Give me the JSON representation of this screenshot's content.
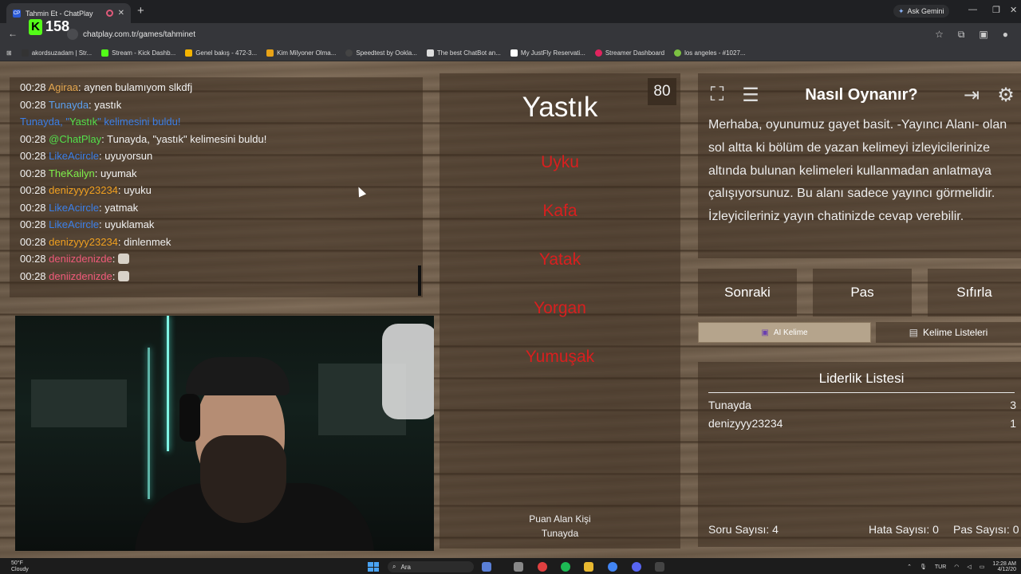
{
  "browser": {
    "tab_title": "Tahmin Et - ChatPlay",
    "tab_favicon": "CP",
    "new_tab": "+",
    "gemini_label": "Ask Gemini",
    "url": "chatplay.com.tr/games/tahminet",
    "kick_count": "158",
    "bookmarks": [
      "akordsuzadam | Str...",
      "Stream - Kick Dashb...",
      "Genel bakış - 472-3...",
      "Kim Milyoner Olma...",
      "Speedtest by Ookla...",
      "The best ChatBot an...",
      "My JustFly Reservati...",
      "Streamer Dashboard",
      "los angeles - #1027..."
    ]
  },
  "chat": {
    "messages": [
      {
        "time": "00:28",
        "user": "Agiraa",
        "sep": ": ",
        "text": "aynen bulamıyom slkdfj",
        "color": "#e3a64f"
      },
      {
        "time": "00:28",
        "user": "Tunayda",
        "sep": ": ",
        "text": "yastık",
        "color": "#5aa0f0"
      },
      {
        "time": "",
        "user": "Tunayda, ",
        "sep": "",
        "text": "",
        "color": "#3b7fe8",
        "special": true
      },
      {
        "time": "00:28",
        "user": "@ChatPlay",
        "sep": ": ",
        "text": "Tunayda, \"yastık\" kelimesini buldu!",
        "color": "#53e04b"
      },
      {
        "time": "00:28",
        "user": "LikeAcircle",
        "sep": ": ",
        "text": "uyuyorsun",
        "color": "#3b7fe8"
      },
      {
        "time": "00:28",
        "user": "TheKailyn",
        "sep": ": ",
        "text": "uyumak",
        "color": "#7ef04a"
      },
      {
        "time": "00:28",
        "user": "denizyyy23234",
        "sep": ": ",
        "text": "uyuku",
        "color": "#f0a020"
      },
      {
        "time": "00:28",
        "user": "LikeAcircle",
        "sep": ": ",
        "text": "yatmak",
        "color": "#3b7fe8"
      },
      {
        "time": "00:28",
        "user": "LikeAcircle",
        "sep": ": ",
        "text": "uyuklamak",
        "color": "#3b7fe8"
      },
      {
        "time": "00:28",
        "user": "denizyyy23234",
        "sep": ": ",
        "text": "dinlenmek",
        "color": "#f0a020"
      },
      {
        "time": "00:28",
        "user": "deniizdenizde",
        "sep": ": ",
        "text": "",
        "color": "#f05a7a",
        "emote": true
      },
      {
        "time": "00:28",
        "user": "deniizdenizde",
        "sep": ": ",
        "text": "",
        "color": "#f05a7a",
        "emote": true
      }
    ],
    "found_line": {
      "user": "Tunayda, ",
      "quote_open": "\"",
      "word": "Yastık",
      "quote_close": "\" ",
      "suffix": "kelimesini buldu!"
    }
  },
  "game": {
    "timer": "80",
    "target_word": "Yastık",
    "taboo_words": [
      "Uyku",
      "Kafa",
      "Yatak",
      "Yorgan",
      "Yumuşak"
    ],
    "scorer_label": "Puan Alan Kişi",
    "scorer_name": "Tunayda"
  },
  "howto": {
    "title": "Nasıl Oynanır?",
    "text": "Merhaba, oyunumuz gayet basit. -Yayıncı Alanı- olan sol altta ki bölüm de yazan kelimeyi izleyicilerinize altında bulunan kelimeleri kullanmadan anlatmaya çalışıyorsunuz. Bu alanı sadece yayıncı görmelidir. İzleyicileriniz yayın chatinizde cevap verebilir."
  },
  "controls": {
    "next": "Sonraki",
    "pass": "Pas",
    "reset": "Sıfırla",
    "ai_word": "AI Kelime",
    "word_lists": "Kelime Listeleri"
  },
  "leaderboard": {
    "title": "Liderlik Listesi",
    "rows": [
      {
        "name": "Tunayda",
        "score": "3"
      },
      {
        "name": "denizyyy23234",
        "score": "1"
      }
    ]
  },
  "stats": {
    "questions": "Soru Sayısı: 4",
    "errors": "Hata Sayısı: 0",
    "passes": "Pas Sayısı: 0"
  },
  "taskbar": {
    "temp": "50°F",
    "condition": "Cloudy",
    "search": "Ara",
    "lang": "TUR",
    "time": "12:28 AM",
    "date": "4/12/20"
  },
  "colors": {
    "taboo": "#d81f1f",
    "kick_green": "#53fc18"
  }
}
